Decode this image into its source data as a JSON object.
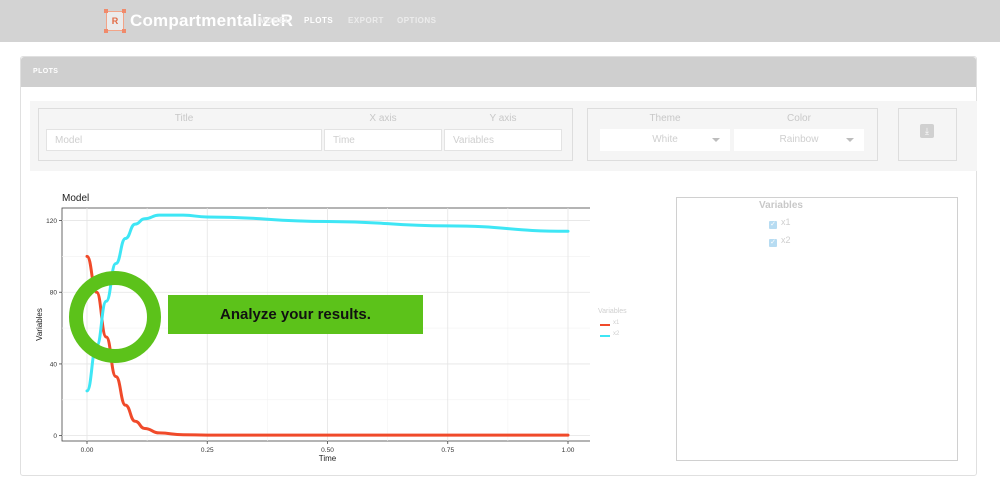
{
  "app": {
    "name": "CompartmentalizeR",
    "logo_letter": "R"
  },
  "nav": {
    "items": [
      {
        "label": "MODEL",
        "active": false
      },
      {
        "label": "PLOTS",
        "active": true
      },
      {
        "label": "EXPORT",
        "active": false
      },
      {
        "label": "OPTIONS",
        "active": false
      }
    ]
  },
  "panel": {
    "title": "PLOTS"
  },
  "controls": {
    "title_label": "Title",
    "title_value": "Model",
    "xaxis_label": "X axis",
    "xaxis_value": "Time",
    "yaxis_label": "Y axis",
    "yaxis_value": "Variables",
    "theme_label": "Theme",
    "theme_value": "White",
    "color_label": "Color",
    "color_value": "Rainbow",
    "download_icon": "download-icon"
  },
  "variables_panel": {
    "title": "Variables",
    "items": [
      {
        "label": "x1",
        "checked": true
      },
      {
        "label": "x2",
        "checked": true
      }
    ]
  },
  "callout": {
    "text": "Analyze your results."
  },
  "colors": {
    "x1": "#f04a2a",
    "x2": "#3ee6f5",
    "accent": "#5cc21a"
  },
  "chart_data": {
    "type": "line",
    "title": "Model",
    "xlabel": "Time",
    "ylabel": "Variables",
    "xlim": [
      0,
      1
    ],
    "ylim": [
      -3,
      127
    ],
    "x_ticks": [
      0,
      0.25,
      0.5,
      0.75,
      1
    ],
    "x_tick_labels": [
      "0.00",
      "0.25",
      "0.50",
      "0.75",
      "1.00"
    ],
    "y_ticks": [
      0,
      40,
      80,
      120
    ],
    "y_tick_labels": [
      "0",
      "40",
      "80",
      "120"
    ],
    "grid": true,
    "legend": {
      "title": "Variables",
      "position": "right"
    },
    "series": [
      {
        "name": "x1",
        "x": [
          0,
          0.02,
          0.04,
          0.06,
          0.08,
          0.1,
          0.12,
          0.15,
          0.2,
          0.25,
          0.5,
          0.75,
          1
        ],
        "values": [
          100,
          80,
          55,
          33,
          17,
          8,
          4,
          1.5,
          0.5,
          0.3,
          0.3,
          0.3,
          0.3
        ]
      },
      {
        "name": "x2",
        "x": [
          0,
          0.02,
          0.04,
          0.06,
          0.08,
          0.1,
          0.12,
          0.15,
          0.2,
          0.25,
          0.5,
          0.75,
          1
        ],
        "values": [
          25,
          50,
          75,
          96,
          110,
          118,
          121,
          123,
          123,
          122,
          119.5,
          117,
          114
        ]
      }
    ]
  }
}
